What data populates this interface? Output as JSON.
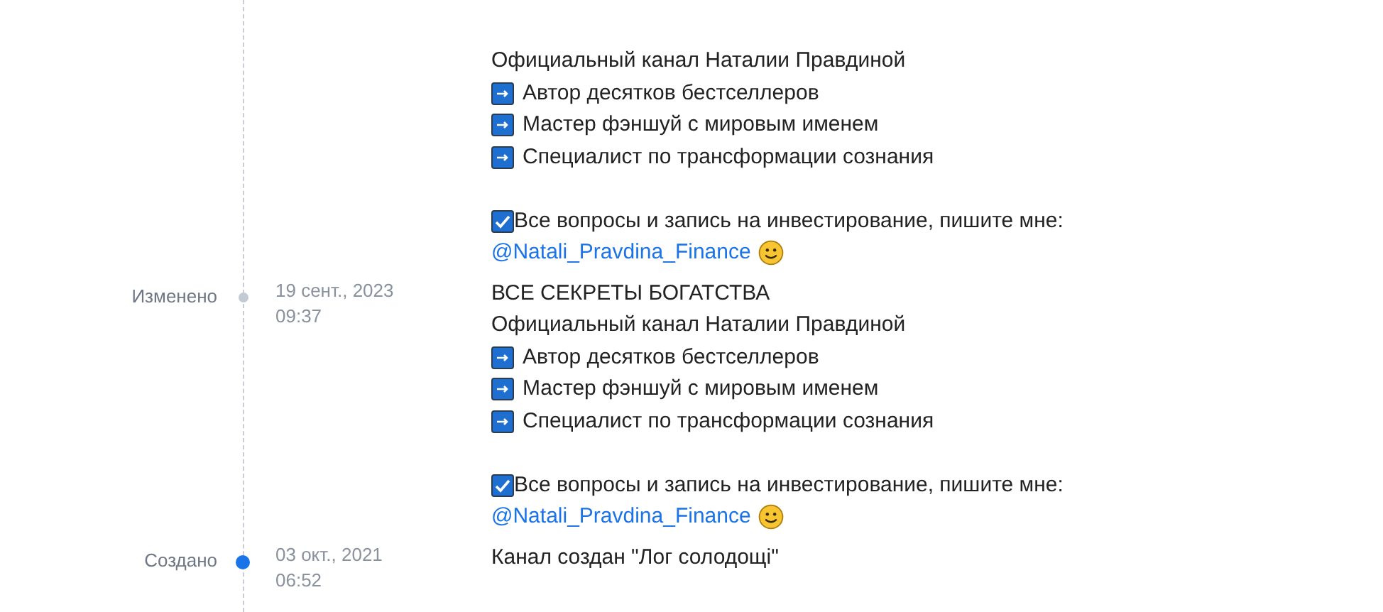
{
  "history": [
    {
      "lines": [
        {
          "kind": "text",
          "text": "Официальный канал Наталии Правдиной"
        },
        {
          "kind": "arrow",
          "text": "Автор десятков бестселлеров"
        },
        {
          "kind": "arrow",
          "text": "Мастер фэншуй с мировым именем"
        },
        {
          "kind": "arrow",
          "text": "Специалист по трансформации сознания"
        },
        {
          "kind": "blank"
        },
        {
          "kind": "check",
          "text": "Все вопросы и запись на инвестирование, пишите мне:"
        },
        {
          "kind": "mention",
          "text": "@Natali_Pravdina_Finance"
        }
      ]
    },
    {
      "label": "Изменено",
      "highlighted": false,
      "date": "19 сент., 2023",
      "time": "09:37",
      "lines": [
        {
          "kind": "text",
          "text": "ВСЕ СЕКРЕТЫ БОГАТСТВА"
        },
        {
          "kind": "text",
          "text": "Официальный канал Наталии Правдиной"
        },
        {
          "kind": "arrow",
          "text": "Автор десятков бестселлеров"
        },
        {
          "kind": "arrow",
          "text": "Мастер фэншуй с мировым именем"
        },
        {
          "kind": "arrow",
          "text": "Специалист по трансформации сознания"
        },
        {
          "kind": "blank"
        },
        {
          "kind": "check",
          "text": "Все вопросы и запись на инвестирование, пишите мне:"
        },
        {
          "kind": "mention",
          "text": "@Natali_Pravdina_Finance"
        }
      ]
    },
    {
      "label": "Создано",
      "highlighted": true,
      "date": "03 окт., 2021",
      "time": "06:52",
      "lines": [
        {
          "kind": "text",
          "text": "Канал создан \"Лог солодощі\""
        }
      ]
    }
  ]
}
